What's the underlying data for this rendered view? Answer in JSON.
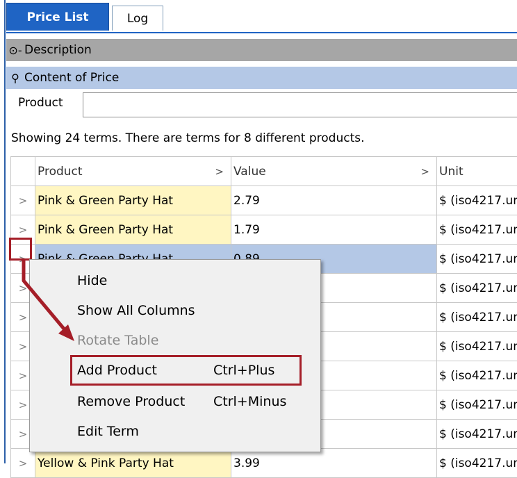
{
  "tabs": [
    {
      "label": "Price List",
      "active": true
    },
    {
      "label": "Log",
      "active": false
    }
  ],
  "sections": {
    "description": "Description",
    "content": "Content of Price"
  },
  "filter": {
    "label": "Product",
    "value": ""
  },
  "summary": "Showing 24 terms. There are terms for 8 different products.",
  "table": {
    "headers": {
      "product": "Product",
      "value": "Value",
      "unit": "Unit",
      "sort_glyph": ">"
    },
    "rows": [
      {
        "product": "Pink & Green Party Hat",
        "value": "2.79",
        "unit": "$ (iso4217.un"
      },
      {
        "product": "Pink & Green Party Hat",
        "value": "1.79",
        "unit": "$ (iso4217.un"
      },
      {
        "product": "Pink & Green Party Hat",
        "value": "0.89",
        "unit": "$ (iso4217.un"
      },
      {
        "product": "",
        "value": "",
        "unit": "$ (iso4217.un"
      },
      {
        "product": "",
        "value": "",
        "unit": "$ (iso4217.un"
      },
      {
        "product": "",
        "value": "",
        "unit": "$ (iso4217.un"
      },
      {
        "product": "",
        "value": "",
        "unit": "$ (iso4217.un"
      },
      {
        "product": "",
        "value": "",
        "unit": "$ (iso4217.un"
      },
      {
        "product": "",
        "value": "",
        "unit": "$ (iso4217.un"
      },
      {
        "product": "Yellow & Pink Party Hat",
        "value": "3.99",
        "unit": "$ (iso4217.un"
      }
    ],
    "expand_glyph": ">"
  },
  "context_menu": {
    "items": [
      {
        "label": "Hide",
        "shortcut": "",
        "disabled": false
      },
      {
        "label": "Show All Columns",
        "shortcut": "",
        "disabled": false
      },
      {
        "label": "Rotate Table",
        "shortcut": "",
        "disabled": true
      },
      {
        "label": "Add Product",
        "shortcut": "Ctrl+Plus",
        "disabled": false
      },
      {
        "label": "Remove Product",
        "shortcut": "Ctrl+Minus",
        "disabled": false
      },
      {
        "label": "Edit Term",
        "shortcut": "",
        "disabled": false
      }
    ]
  },
  "colors": {
    "tab_active": "#1f64c4",
    "highlight": "#b4c8e6",
    "product_cell": "#fff6c2",
    "annotation": "#a51e28"
  }
}
